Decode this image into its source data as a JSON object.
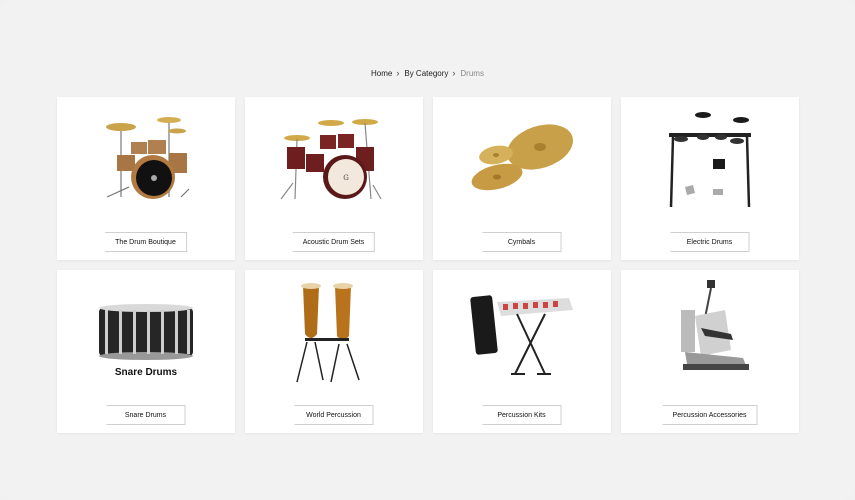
{
  "breadcrumb": {
    "items": [
      "Home",
      "By Category"
    ],
    "current": "Drums"
  },
  "categories": [
    {
      "label": "The Drum Boutique",
      "icon": "drum-kit-icon"
    },
    {
      "label": "Acoustic Drum Sets",
      "icon": "acoustic-drum-set-icon"
    },
    {
      "label": "Cymbals",
      "icon": "cymbals-icon"
    },
    {
      "label": "Electric Drums",
      "icon": "electric-drums-icon"
    },
    {
      "label": "Snare Drums",
      "icon": "snare-drum-icon",
      "image_caption": "Snare Drums"
    },
    {
      "label": "World Percussion",
      "icon": "conga-drums-icon"
    },
    {
      "label": "Percussion Kits",
      "icon": "percussion-kit-icon"
    },
    {
      "label": "Percussion Accessories",
      "icon": "drum-pedal-icon"
    }
  ]
}
